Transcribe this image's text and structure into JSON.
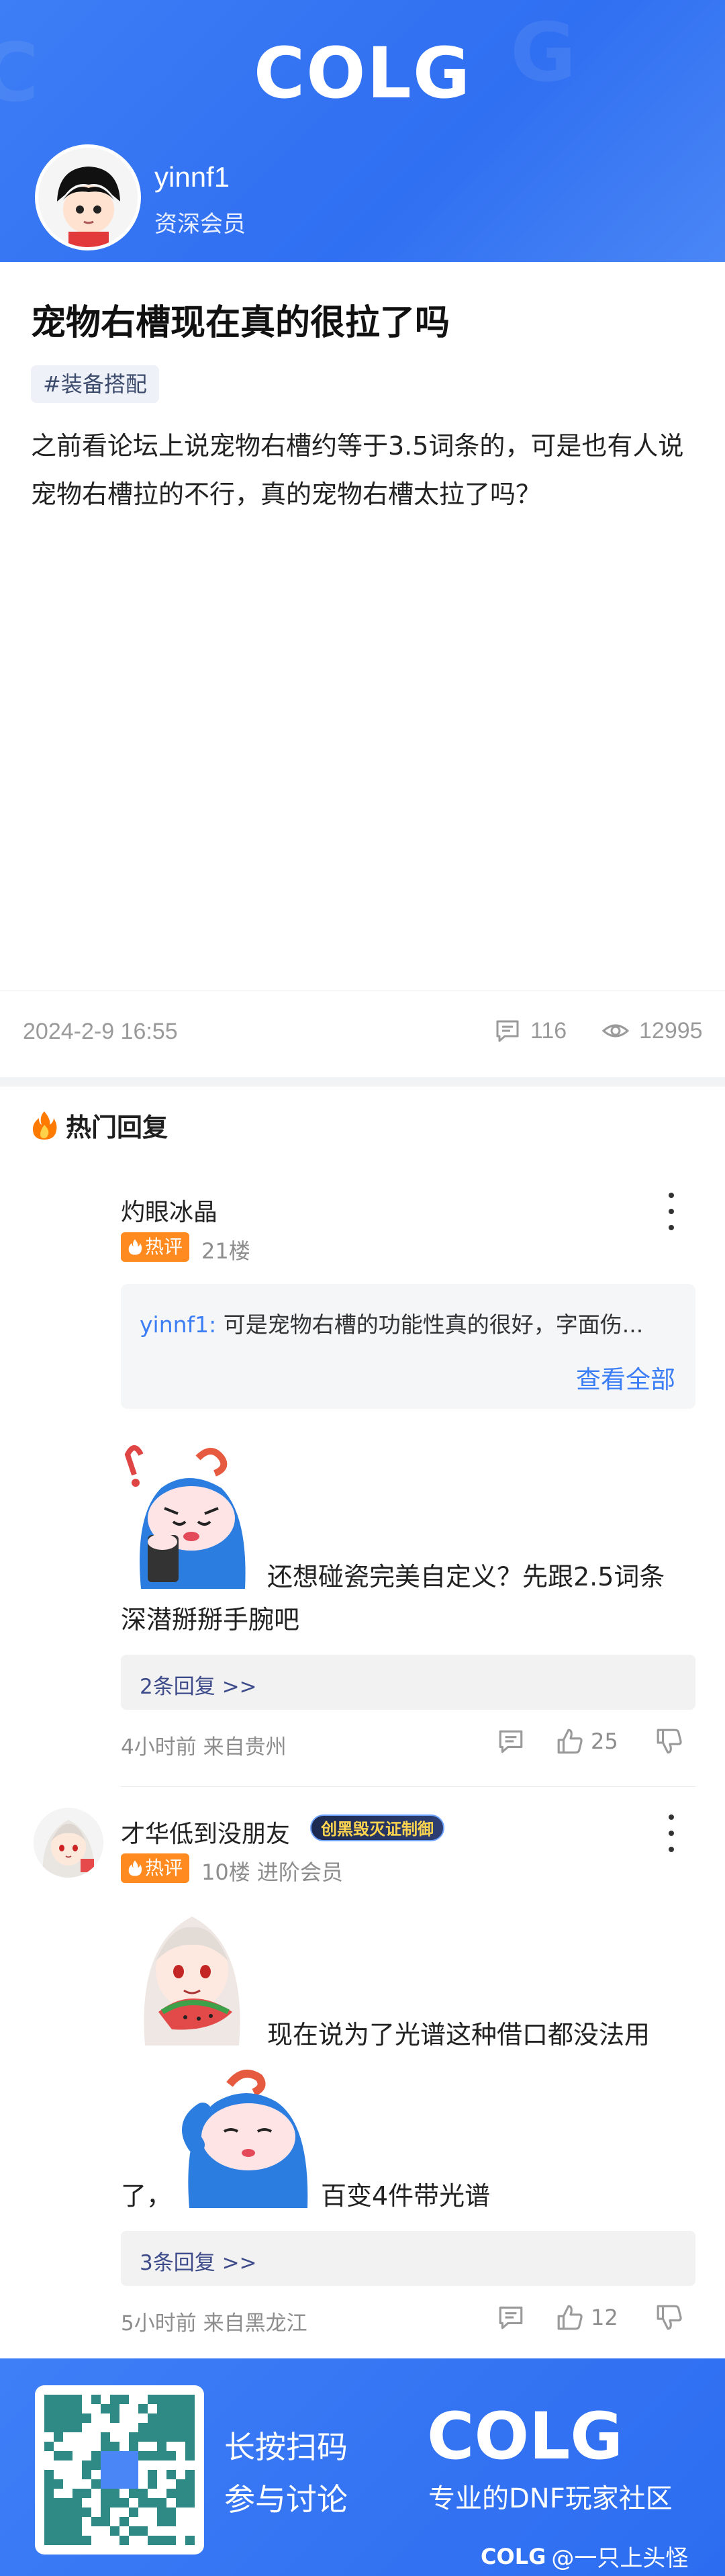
{
  "header": {
    "logo": "COLG",
    "username": "yinnf1",
    "user_tag": "资深会员"
  },
  "post": {
    "title": "宠物右槽现在真的很拉了吗",
    "tag": "#装备搭配",
    "body": "之前看论坛上说宠物右槽约等于3.5词条的，可是也有人说宠物右槽拉的不行，真的宠物右槽太拉了吗？",
    "date": "2024-2-9 16:55",
    "comments": "116",
    "views": "12995"
  },
  "hot_section": {
    "title": "热门回复"
  },
  "comments": [
    {
      "name": "灼眼冰晶",
      "badge": "热评",
      "floor": "21楼",
      "quote_user": "yinnf1:",
      "quote_text": " 可是宠物右槽的功能性真的很好，字面伤...",
      "quote_all": "查看全部",
      "text_line1": "还想碰瓷完美自定义？先跟2.5词条",
      "text_line2": "深潜掰掰手腕吧",
      "replies": "2条回复 >>",
      "time": "4小时前 来自贵州",
      "likes": "25"
    },
    {
      "name": "才华低到没朋友",
      "title_badge": "创黑毁灭证制御",
      "badge": "热评",
      "floor": "10楼 进阶会员",
      "text_line1": "现在说为了光谱这种借口都没法用",
      "text_line2_a": "了，",
      "text_line2_b": "百变4件带光谱",
      "replies": "3条回复 >>",
      "time": "5小时前 来自黑龙江",
      "likes": "12"
    }
  ],
  "footer": {
    "cta1": "长按扫码",
    "cta2": "参与讨论",
    "logo": "COLG",
    "slogan": "专业的DNF玩家社区",
    "watermark_logo": "COLG",
    "watermark_text": "@一只上头怪"
  },
  "colors": {
    "brand": "#2f6ff1",
    "hot": "#ff8a1f",
    "link": "#3b7df5"
  }
}
